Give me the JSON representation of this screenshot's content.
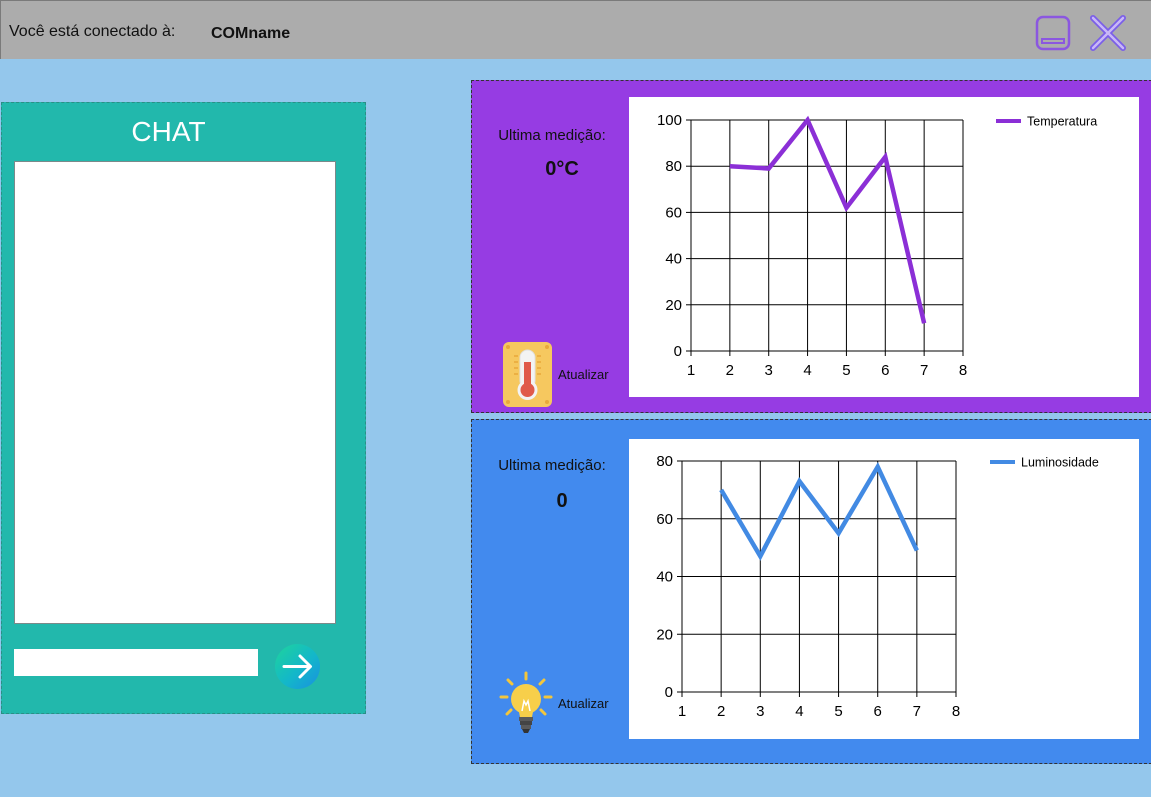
{
  "header": {
    "connection_label": "Você está conectado à:",
    "port_name": "COMname",
    "minimize_icon": "minimize-icon",
    "close_icon": "close-icon"
  },
  "chat": {
    "title": "CHAT",
    "message_text": "",
    "send_icon": "arrow-right-icon"
  },
  "temperature": {
    "last_label": "Ultima medição:",
    "value": "0°C",
    "refresh_label": "Atualizar",
    "icon": "thermometer-icon",
    "color": "#963ce3"
  },
  "luminosity": {
    "last_label": "Ultima medição:",
    "value": "0",
    "refresh_label": "Atualizar",
    "icon": "lightbulb-icon",
    "color": "#428aee"
  },
  "chart_data": [
    {
      "type": "line",
      "series": [
        {
          "name": "Temperatura",
          "color": "#8b2fd6",
          "x": [
            2,
            3,
            4,
            5,
            6,
            7
          ],
          "values": [
            80,
            79,
            100,
            62,
            84,
            12
          ]
        }
      ],
      "xlim": [
        1,
        8
      ],
      "xticks": [
        1,
        2,
        3,
        4,
        5,
        6,
        7,
        8
      ],
      "ylim": [
        0,
        100
      ],
      "yticks": [
        0,
        20,
        40,
        60,
        80,
        100
      ],
      "grid": true,
      "legend": "top-right"
    },
    {
      "type": "line",
      "series": [
        {
          "name": "Luminosidade",
          "color": "#428ae3",
          "x": [
            2,
            3,
            4,
            5,
            6,
            7
          ],
          "values": [
            70,
            47,
            73,
            55,
            78,
            49
          ]
        }
      ],
      "xlim": [
        1,
        8
      ],
      "xticks": [
        1,
        2,
        3,
        4,
        5,
        6,
        7,
        8
      ],
      "ylim": [
        0,
        80
      ],
      "yticks": [
        0,
        20,
        40,
        60,
        80
      ],
      "grid": true,
      "legend": "top-right"
    }
  ]
}
